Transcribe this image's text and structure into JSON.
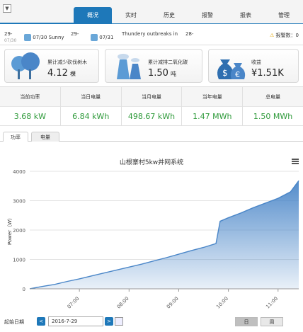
{
  "nav": {
    "menu_icon": "▼",
    "tabs": [
      "概况",
      "实时",
      "历史",
      "报警",
      "报表",
      "管理"
    ],
    "active_tab": 0
  },
  "weather": {
    "day1_date": "29-",
    "day1_sub": "07/30",
    "day2_date": "07/30 Sunny",
    "day3_date": "29-",
    "day4_date": "07/31",
    "forecast_text": "Thundery outbreaks in",
    "day5_date": "28-",
    "alarm_label": "报警数：",
    "alarm_count": "0"
  },
  "cards": [
    {
      "label": "累计减少砍伐树木",
      "value": "4.12",
      "unit": "棵",
      "icon": "trees-icon"
    },
    {
      "label": "累计减排二氧化碳",
      "value": "1.50",
      "unit": "吨",
      "icon": "factory-icon"
    },
    {
      "label": "收益",
      "value": "¥1.51K",
      "unit": "",
      "icon": "money-bags-icon"
    }
  ],
  "stats": [
    {
      "head": "当前功率",
      "value": "3.68 kW"
    },
    {
      "head": "当日电量",
      "value": "6.84 kWh"
    },
    {
      "head": "当月电量",
      "value": "498.67 kWh"
    },
    {
      "head": "当年电量",
      "value": "1.47 MWh"
    },
    {
      "head": "总电量",
      "value": "1.50 MWh"
    }
  ],
  "chart_tabs": [
    "功率",
    "电量"
  ],
  "footer": {
    "start_label": "起始日期",
    "date_value": "2016-7-29",
    "prev": "<",
    "next": ">",
    "seg1": "日",
    "seg2": "周"
  },
  "chart_data": {
    "type": "area",
    "title": "山根寨村5kw并网系统",
    "ylabel": "Power（W）",
    "ylim": [
      0,
      4000
    ],
    "yticks": [
      0,
      1000,
      2000,
      3000,
      4000
    ],
    "xticks": [
      "07:00",
      "08:00",
      "09:00",
      "10:00",
      "11:00"
    ],
    "x": [
      "06:00",
      "06:15",
      "06:30",
      "06:45",
      "07:00",
      "07:15",
      "07:30",
      "07:45",
      "08:00",
      "08:15",
      "08:30",
      "08:45",
      "09:00",
      "09:15",
      "09:30",
      "09:45",
      "09:50",
      "10:00",
      "10:15",
      "10:30",
      "10:45",
      "11:00",
      "11:15",
      "11:25"
    ],
    "values": [
      0,
      80,
      150,
      250,
      340,
      440,
      540,
      640,
      740,
      840,
      950,
      1060,
      1180,
      1300,
      1410,
      1540,
      2300,
      2420,
      2580,
      2760,
      2920,
      3080,
      3300,
      3680
    ],
    "color": "#4a86c8",
    "grid": true
  }
}
